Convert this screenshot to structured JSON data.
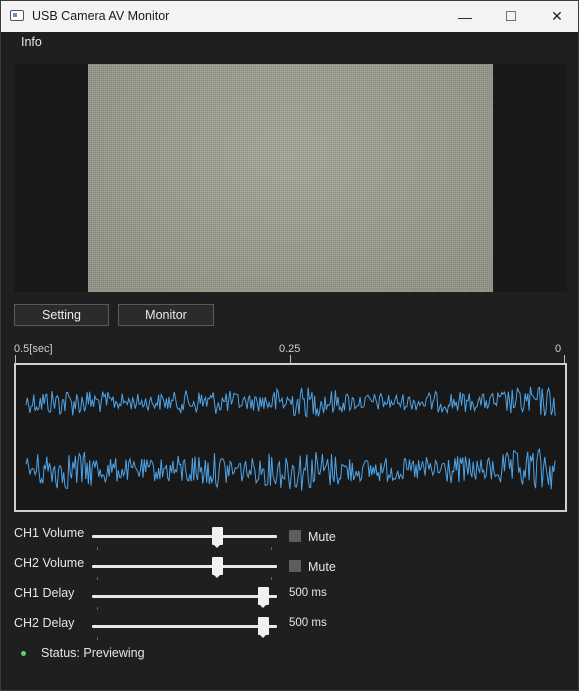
{
  "window": {
    "title": "USB Camera AV Monitor"
  },
  "titlebar": {
    "minimize_icon": "—",
    "maximize_icon": "□",
    "close_icon": "✕"
  },
  "menu": {
    "items": [
      "Info"
    ]
  },
  "buttons": {
    "setting": "Setting",
    "monitor": "Monitor"
  },
  "waveform_axis": {
    "left": "0.5[sec]",
    "middle": "0.25",
    "right": "0"
  },
  "waveform_colors": {
    "trace": "#4ea3e6"
  },
  "controls": {
    "ch1_volume": {
      "label": "CH1 Volume",
      "level": 0.72,
      "mute_label": "Mute",
      "muted": false
    },
    "ch2_volume": {
      "label": "CH2 Volume",
      "level": 0.72,
      "mute_label": "Mute",
      "muted": false
    },
    "ch1_delay": {
      "label": "CH1 Delay",
      "level": 1.0,
      "value": "500 ms"
    },
    "ch2_delay": {
      "label": "CH2 Delay",
      "level": 1.0,
      "value": "500 ms"
    }
  },
  "status": {
    "text": "Status: Previewing",
    "color": "#5fd36a"
  }
}
